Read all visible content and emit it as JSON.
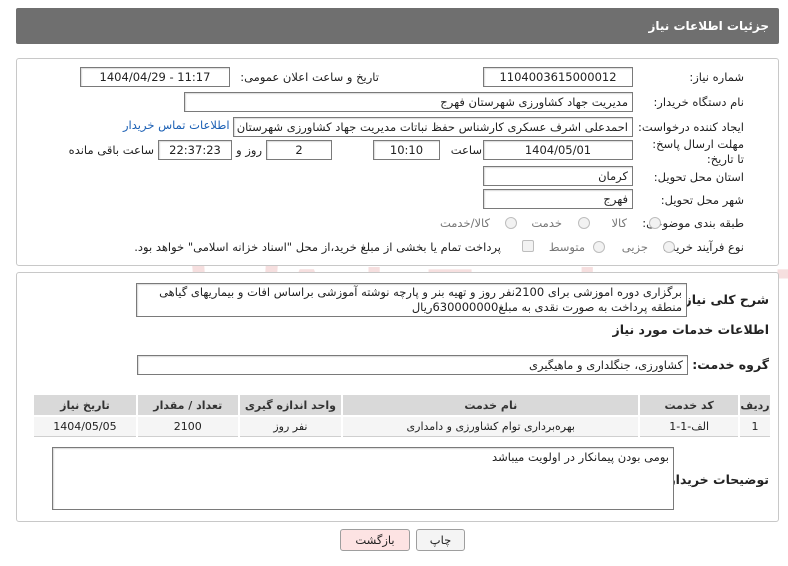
{
  "header": {
    "title": "جزئیات اطلاعات نیاز"
  },
  "form": {
    "need_number_label": "شماره نیاز:",
    "need_number": "1104003615000012",
    "announce_label": "تاریخ و ساعت اعلان عمومی:",
    "announce_value": "1404/04/29 - 11:17",
    "buyer_org_label": "نام دستگاه خریدار:",
    "buyer_org": "مدیریت جهاد کشاورزی شهرستان فهرج",
    "creator_label": "ایجاد کننده درخواست:",
    "creator": "احمدعلی اشرف عسکری کارشناس حفظ نباتات مدیریت جهاد کشاورزی شهرستان فهرج",
    "contact_link": "اطلاعات تماس خریدار",
    "deadline_label": "مهلت ارسال پاسخ: تا تاریخ:",
    "deadline_date": "1404/05/01",
    "time_label": "ساعت",
    "deadline_time": "10:10",
    "days_value": "2",
    "days_label": "روز و",
    "remaining_time": "22:37:23",
    "remaining_label": "ساعت باقی مانده",
    "province_label": "استان محل تحویل:",
    "province": "کرمان",
    "city_label": "شهر محل تحویل:",
    "city": "فهرج",
    "category_label": "طبقه بندی موضوعی:",
    "category_options": [
      "کالا",
      "خدمت",
      "کالا/خدمت"
    ],
    "process_label": "نوع فرآیند خرید :",
    "process_options": [
      "جزیی",
      "متوسط"
    ],
    "payment_note": "پرداخت تمام یا بخشی از مبلغ خرید،از محل \"اسناد خزانه اسلامی\" خواهد بود."
  },
  "description": {
    "label": "شرح کلی نیاز:",
    "text": "برگزاری دوره اموزشی برای 2100نفر روز و تهیه بنر و پارچه نوشته آموزشی براساس افات و بیماریهای گیاهی منطقه پرداخت به صورت نقدی به مبلغ630000000ریال"
  },
  "services": {
    "section_title": "اطلاعات خدمات مورد نیاز",
    "group_label": "گروه خدمت:",
    "group_value": "کشاورزی، جنگلداری و ماهیگیری",
    "columns": [
      "ردیف",
      "کد خدمت",
      "نام خدمت",
      "واحد اندازه گیری",
      "تعداد / مقدار",
      "تاریخ نیاز"
    ],
    "rows": [
      [
        "1",
        "الف-1-1",
        "بهره‌برداری توام کشاورزی و دامداری",
        "نفر روز",
        "2100",
        "1404/05/05"
      ]
    ]
  },
  "buyer_notes": {
    "label": "توضیحات خریدار:",
    "text": "بومی بودن پیمانکار در اولویت میباشد"
  },
  "buttons": {
    "print": "چاپ",
    "back": "بازگشت"
  },
  "watermark": {
    "text": "AriaTender.neT"
  },
  "colors": {
    "header_bg": "#6f6f6f",
    "link": "#1a5fb4",
    "back_button_bg": "#fde3e3"
  }
}
